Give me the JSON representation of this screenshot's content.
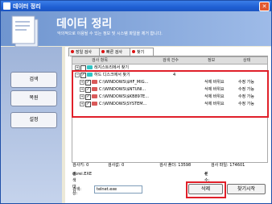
{
  "window": {
    "title": "데이터 정리",
    "close_glyph": "✕"
  },
  "header": {
    "title": "데이터 정리",
    "subtitle": "악의적으로 이용될 수 있는 정보 및 시스템 파일을 제거 합니다."
  },
  "sidebar": {
    "items": [
      {
        "label": "검색"
      },
      {
        "label": "복원"
      },
      {
        "label": "설정"
      }
    ]
  },
  "tabs": [
    {
      "label": "장일 검사"
    },
    {
      "label": "빠른 검사"
    },
    {
      "label": "찾기"
    }
  ],
  "grid": {
    "columns": [
      "검사 항목",
      "검색 건수",
      "정보",
      "상태"
    ],
    "rows": [
      {
        "name": "레지스트리에서 찾기",
        "count": "",
        "info": "",
        "state": "",
        "level": 0,
        "checked": false,
        "icon": "cyan"
      },
      {
        "name": "하드 디스크에서 찾기",
        "count": "4",
        "info": "",
        "state": "",
        "level": 0,
        "checked": true,
        "icon": "cyan"
      },
      {
        "name": "C:\\WINDOWS\\$HF_MIG...",
        "count": "",
        "info": "삭제 바위요",
        "state": "수정 가능",
        "level": 1,
        "checked": true,
        "icon": "red"
      },
      {
        "name": "C:\\WINDOWS\\$NTUNI...",
        "count": "",
        "info": "삭제 바위요",
        "state": "수정 가능",
        "level": 1,
        "checked": true,
        "icon": "red"
      },
      {
        "name": "C:\\WINDOWS\\$KB897E...",
        "count": "",
        "info": "삭제 바위요",
        "state": "수정 가능",
        "level": 1,
        "checked": true,
        "icon": "red"
      },
      {
        "name": "C:\\WINDOWS\\SYSTEM...",
        "count": "",
        "info": "삭제 바위요",
        "state": "수정 가능",
        "level": 1,
        "checked": true,
        "icon": "red"
      }
    ]
  },
  "stats": {
    "reg_label": "검사키: 0",
    "value_label": "검사값: 0",
    "folder_label": "검사 폴더: 13598",
    "file_label": "검사 파일: 174601",
    "target_label": "검색 대상: ",
    "target_value": "dorei.EXE",
    "count_label": "건수: ",
    "count_value": "4"
  },
  "search": {
    "label": "검색: ",
    "value": "telnet.exe"
  },
  "buttons": {
    "delete": "삭제",
    "find_start": "찾기시작"
  }
}
